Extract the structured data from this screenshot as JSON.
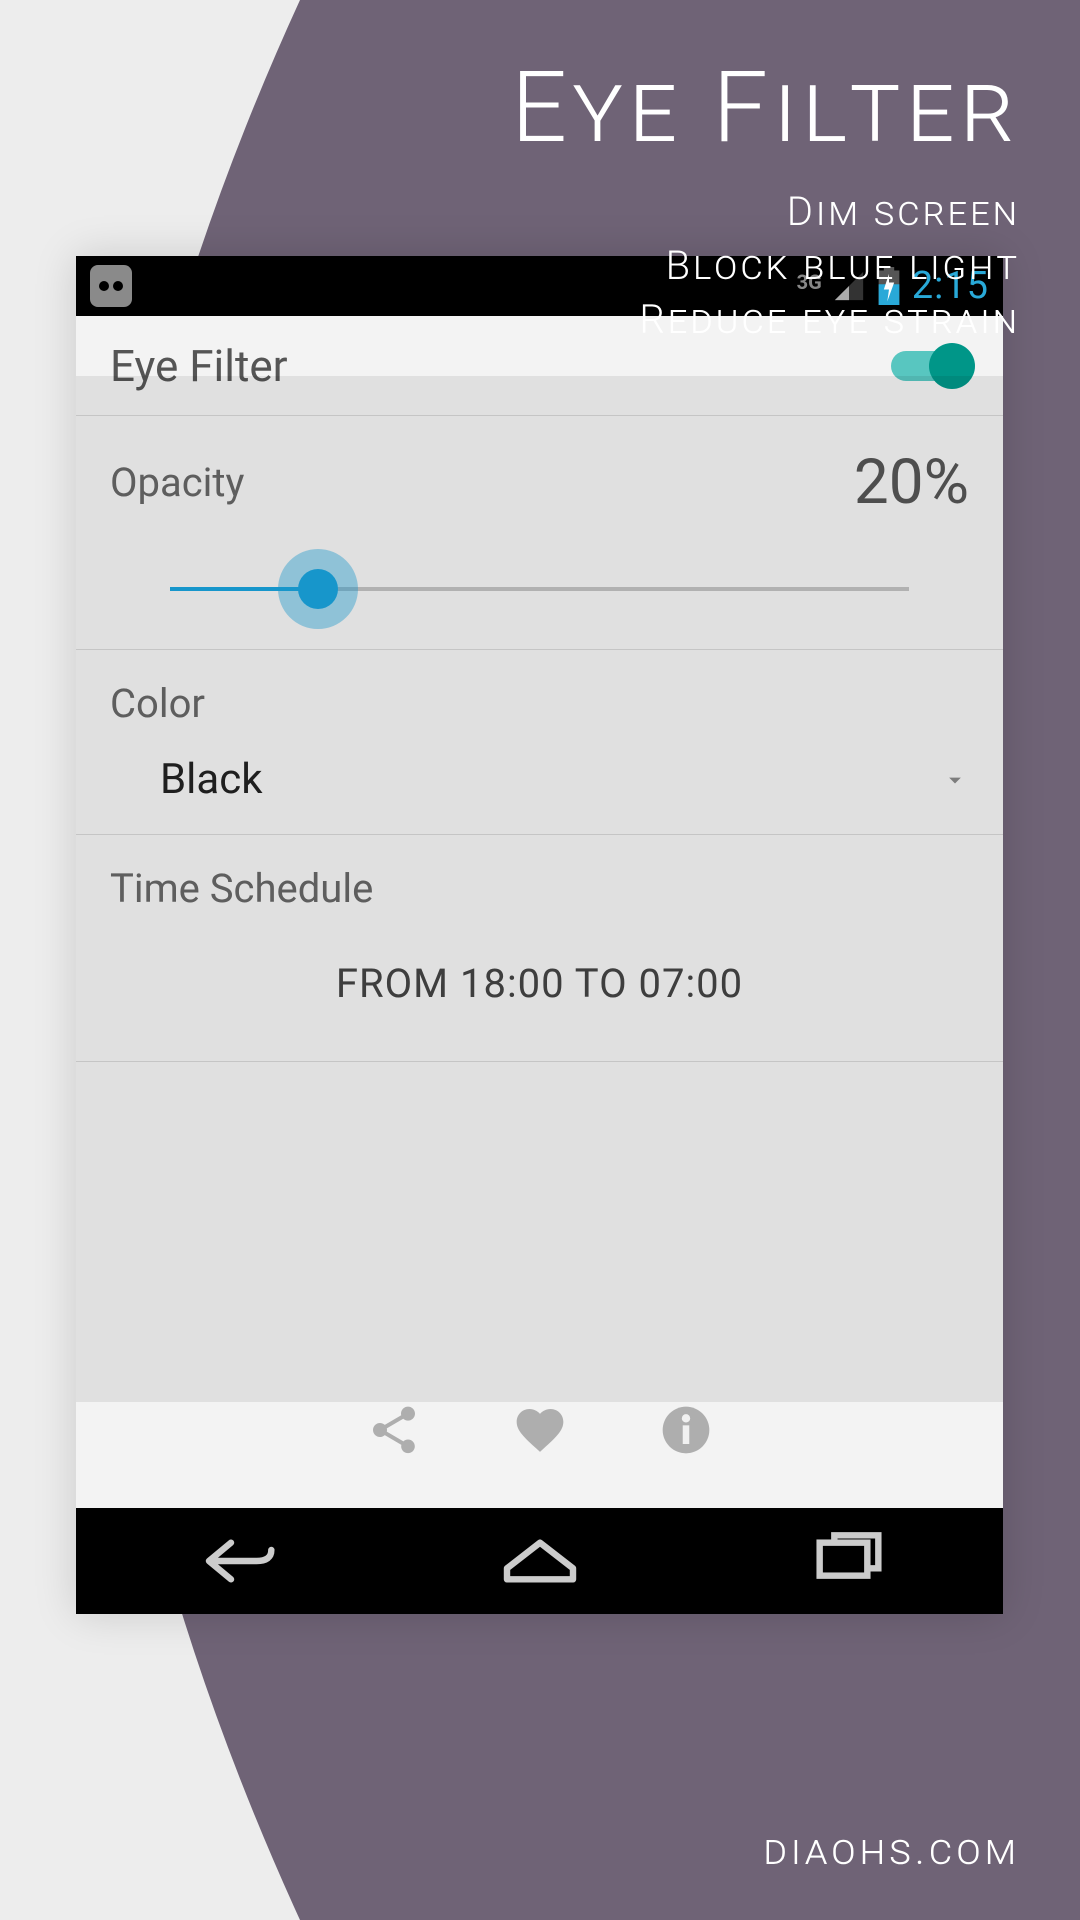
{
  "promo": {
    "title": "Eye Filter",
    "line1": "Dim screen",
    "line2": "Block blue light",
    "line3": "Reduce eye strain"
  },
  "footer": "diaohs.com",
  "status": {
    "network": "3G",
    "clock": "2:15"
  },
  "app": {
    "title": "Eye Filter",
    "enabled": true,
    "opacity": {
      "label": "Opacity",
      "value_text": "20%",
      "percent": 20
    },
    "color": {
      "label": "Color",
      "selected": "Black"
    },
    "schedule": {
      "label": "Time Schedule",
      "value": "FROM 18:00 TO 07:00"
    }
  },
  "colors": {
    "accent_teal": "#009688",
    "accent_blue": "#1aa3dd",
    "bg_purple": "#6f6376",
    "bg_light": "#ededed"
  }
}
